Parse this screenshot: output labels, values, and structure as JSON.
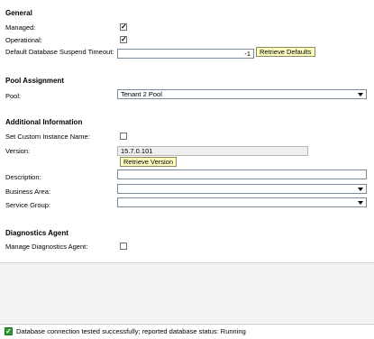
{
  "general": {
    "title": "General",
    "managed_label": "Managed:",
    "managed_checked": true,
    "operational_label": "Operational:",
    "operational_checked": true,
    "timeout_label": "Default Database Suspend Timeout:",
    "timeout_value": "-1",
    "retrieve_defaults_label": "Retrieve Defaults"
  },
  "pool_assignment": {
    "title": "Pool Assignment",
    "pool_label": "Pool:",
    "pool_value": "Tenant 2 Pool"
  },
  "additional_info": {
    "title": "Additional Information",
    "custom_name_label": "Set Custom Instance Name:",
    "custom_name_checked": false,
    "version_label": "Version:",
    "version_value": "15.7.0.101",
    "retrieve_version_label": "Retrieve Version",
    "description_label": "Description:",
    "description_value": "",
    "business_area_label": "Business Area:",
    "business_area_value": "",
    "service_group_label": "Service Group:",
    "service_group_value": ""
  },
  "diagnostics": {
    "title": "Diagnostics Agent",
    "manage_label": "Manage Diagnostics Agent:",
    "manage_checked": false
  },
  "status": {
    "message": "Database connection tested successfully; reported database status: Running",
    "icon": "success-check-icon",
    "color": "#2e9b2e"
  }
}
